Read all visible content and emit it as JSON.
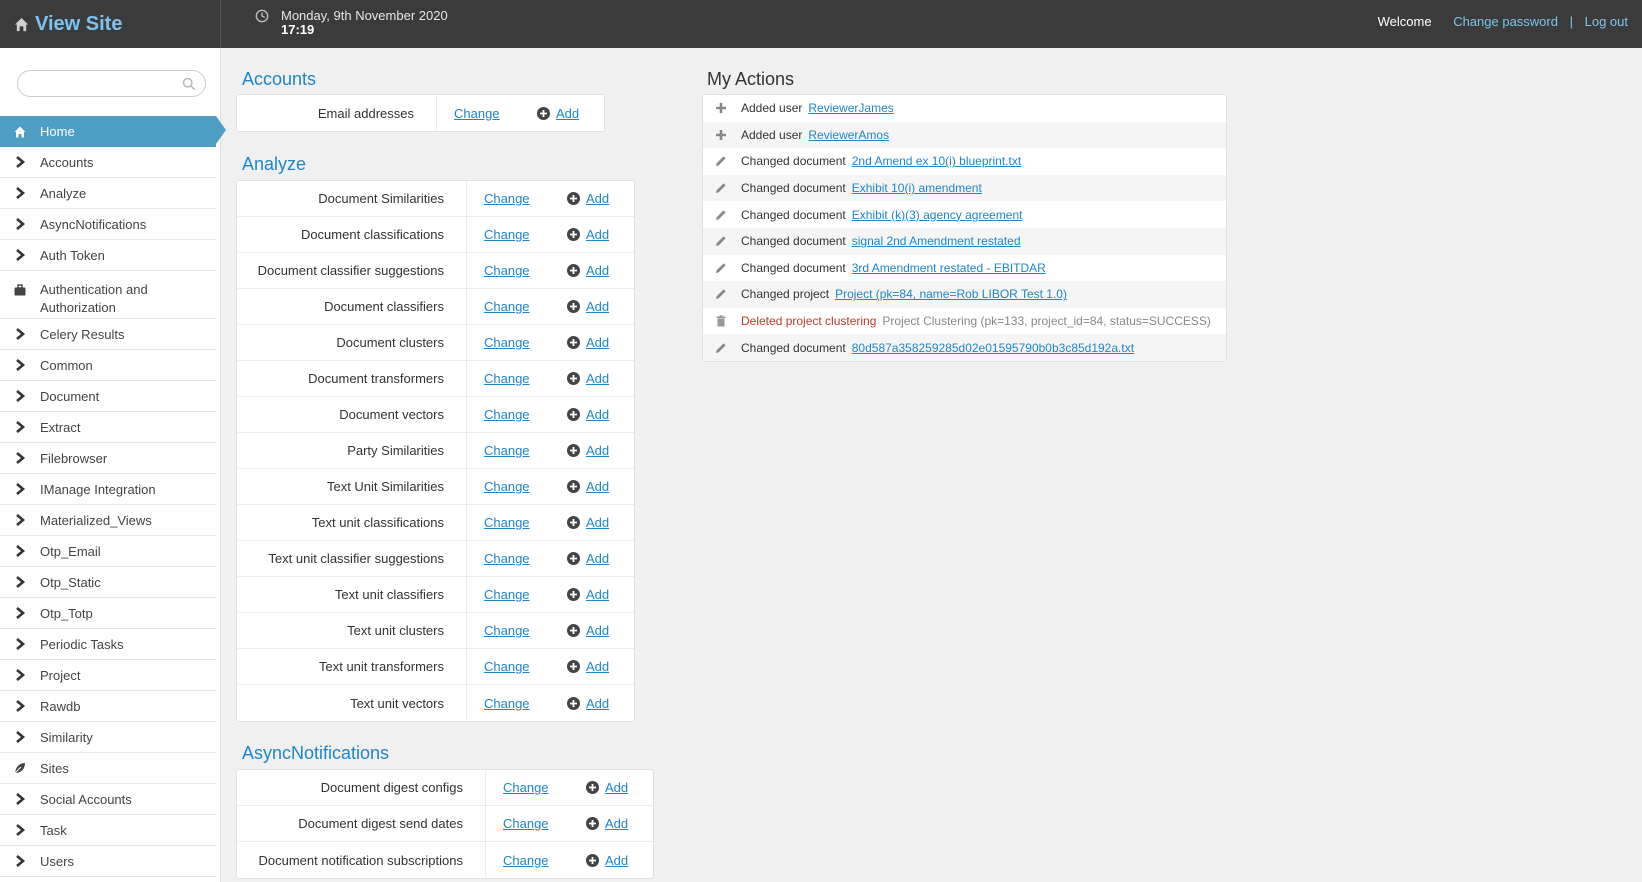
{
  "header": {
    "brand": "View Site",
    "date": "Monday, 9th November 2020",
    "time": "17:19",
    "welcome": "Welcome",
    "change_password": "Change password",
    "separator": "|",
    "logout": "Log out"
  },
  "sidebar": {
    "search_placeholder": "",
    "items": [
      {
        "label": "Home",
        "icon": "home-icon",
        "active": true
      },
      {
        "label": "Accounts",
        "icon": "chevron-right-icon"
      },
      {
        "label": "Analyze",
        "icon": "chevron-right-icon"
      },
      {
        "label": "AsyncNotifications",
        "icon": "chevron-right-icon"
      },
      {
        "label": "Auth Token",
        "icon": "chevron-right-icon"
      },
      {
        "label": "Authentication and Authorization",
        "icon": "briefcase-icon"
      },
      {
        "label": "Celery Results",
        "icon": "chevron-right-icon"
      },
      {
        "label": "Common",
        "icon": "chevron-right-icon"
      },
      {
        "label": "Document",
        "icon": "chevron-right-icon"
      },
      {
        "label": "Extract",
        "icon": "chevron-right-icon"
      },
      {
        "label": "Filebrowser",
        "icon": "chevron-right-icon"
      },
      {
        "label": "IManage Integration",
        "icon": "chevron-right-icon"
      },
      {
        "label": "Materialized_Views",
        "icon": "chevron-right-icon"
      },
      {
        "label": "Otp_Email",
        "icon": "chevron-right-icon"
      },
      {
        "label": "Otp_Static",
        "icon": "chevron-right-icon"
      },
      {
        "label": "Otp_Totp",
        "icon": "chevron-right-icon"
      },
      {
        "label": "Periodic Tasks",
        "icon": "chevron-right-icon"
      },
      {
        "label": "Project",
        "icon": "chevron-right-icon"
      },
      {
        "label": "Rawdb",
        "icon": "chevron-right-icon"
      },
      {
        "label": "Similarity",
        "icon": "chevron-right-icon"
      },
      {
        "label": "Sites",
        "icon": "leaf-icon"
      },
      {
        "label": "Social Accounts",
        "icon": "chevron-right-icon"
      },
      {
        "label": "Task",
        "icon": "chevron-right-icon"
      },
      {
        "label": "Users",
        "icon": "chevron-right-icon"
      }
    ]
  },
  "modules": {
    "change_label": "Change",
    "add_label": "Add",
    "accounts": {
      "title": "Accounts",
      "models": [
        "Email addresses"
      ]
    },
    "analyze": {
      "title": "Analyze",
      "models": [
        "Document Similarities",
        "Document classifications",
        "Document classifier suggestions",
        "Document classifiers",
        "Document clusters",
        "Document transformers",
        "Document vectors",
        "Party Similarities",
        "Text Unit Similarities",
        "Text unit classifications",
        "Text unit classifier suggestions",
        "Text unit classifiers",
        "Text unit clusters",
        "Text unit transformers",
        "Text unit vectors"
      ]
    },
    "asyncnotifications": {
      "title": "AsyncNotifications",
      "models": [
        "Document digest configs",
        "Document digest send dates",
        "Document notification subscriptions"
      ]
    }
  },
  "my_actions": {
    "title": "My Actions",
    "items": [
      {
        "icon": "plus-icon",
        "verb": "Added user",
        "object": "ReviewerJames",
        "link": true
      },
      {
        "icon": "plus-icon",
        "verb": "Added user",
        "object": "ReviewerAmos",
        "link": true
      },
      {
        "icon": "pencil-icon",
        "verb": "Changed document",
        "object": "2nd Amend ex 10(i) blueprint.txt",
        "link": true
      },
      {
        "icon": "pencil-icon",
        "verb": "Changed document",
        "object": "Exhibit 10(i) amendment",
        "link": true
      },
      {
        "icon": "pencil-icon",
        "verb": "Changed document",
        "object": "Exhibit (k)(3) agency agreement",
        "link": true
      },
      {
        "icon": "pencil-icon",
        "verb": "Changed document",
        "object": "signal 2nd Amendment restated",
        "link": true
      },
      {
        "icon": "pencil-icon",
        "verb": "Changed document",
        "object": "3rd Amendment restated - EBITDAR",
        "link": true
      },
      {
        "icon": "pencil-icon",
        "verb": "Changed project",
        "object": "Project (pk=84, name=Rob LIBOR Test 1.0)",
        "link": true
      },
      {
        "icon": "trash-icon",
        "verb": "Deleted project clustering",
        "object": "Project Clustering (pk=133, project_id=84, status=SUCCESS)",
        "link": false,
        "deleted": true
      },
      {
        "icon": "pencil-icon",
        "verb": "Changed document",
        "object": "80d587a358259285d02e01595790b0b3c85d192a.txt",
        "link": true
      }
    ]
  },
  "colors": {
    "topbar": "#3b3b3b",
    "brand": "#7cc4ef",
    "link": "#1f86c9",
    "active_nav": "#4e9ec4",
    "deleted": "#c0392b"
  }
}
